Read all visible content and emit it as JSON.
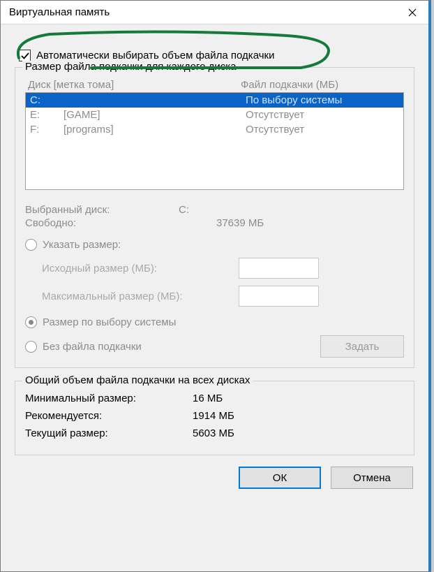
{
  "window_title": "Виртуальная память",
  "auto_checkbox_label": "Автоматически выбирать объем файла подкачки",
  "group1_title": "Размер файла подкачки для каждого диска",
  "drive_header_col1": "Диск [метка тома]",
  "drive_header_col2": "Файл подкачки (МБ)",
  "drives": [
    {
      "letter": "C:",
      "label": "",
      "pagefile": "По выбору системы",
      "selected": true
    },
    {
      "letter": "E:",
      "label": "[GAME]",
      "pagefile": "Отсутствует",
      "selected": false
    },
    {
      "letter": "F:",
      "label": "[programs]",
      "pagefile": "Отсутствует",
      "selected": false
    }
  ],
  "selected_drive_label": "Выбранный диск:",
  "selected_drive_value": "C:",
  "free_space_label": "Свободно:",
  "free_space_value": "37639 МБ",
  "radio_custom_label": "Указать размер:",
  "initial_size_label": "Исходный размер (МБ):",
  "max_size_label": "Максимальный размер (МБ):",
  "radio_system_label": "Размер по выбору системы",
  "radio_none_label": "Без файла подкачки",
  "set_button_label": "Задать",
  "group2_title": "Общий объем файла подкачки на всех дисках",
  "min_label": "Минимальный размер:",
  "min_value": "16 МБ",
  "rec_label": "Рекомендуется:",
  "rec_value": "1914 МБ",
  "cur_label": "Текущий размер:",
  "cur_value": "5603 МБ",
  "ok_label": "ОК",
  "cancel_label": "Отмена"
}
